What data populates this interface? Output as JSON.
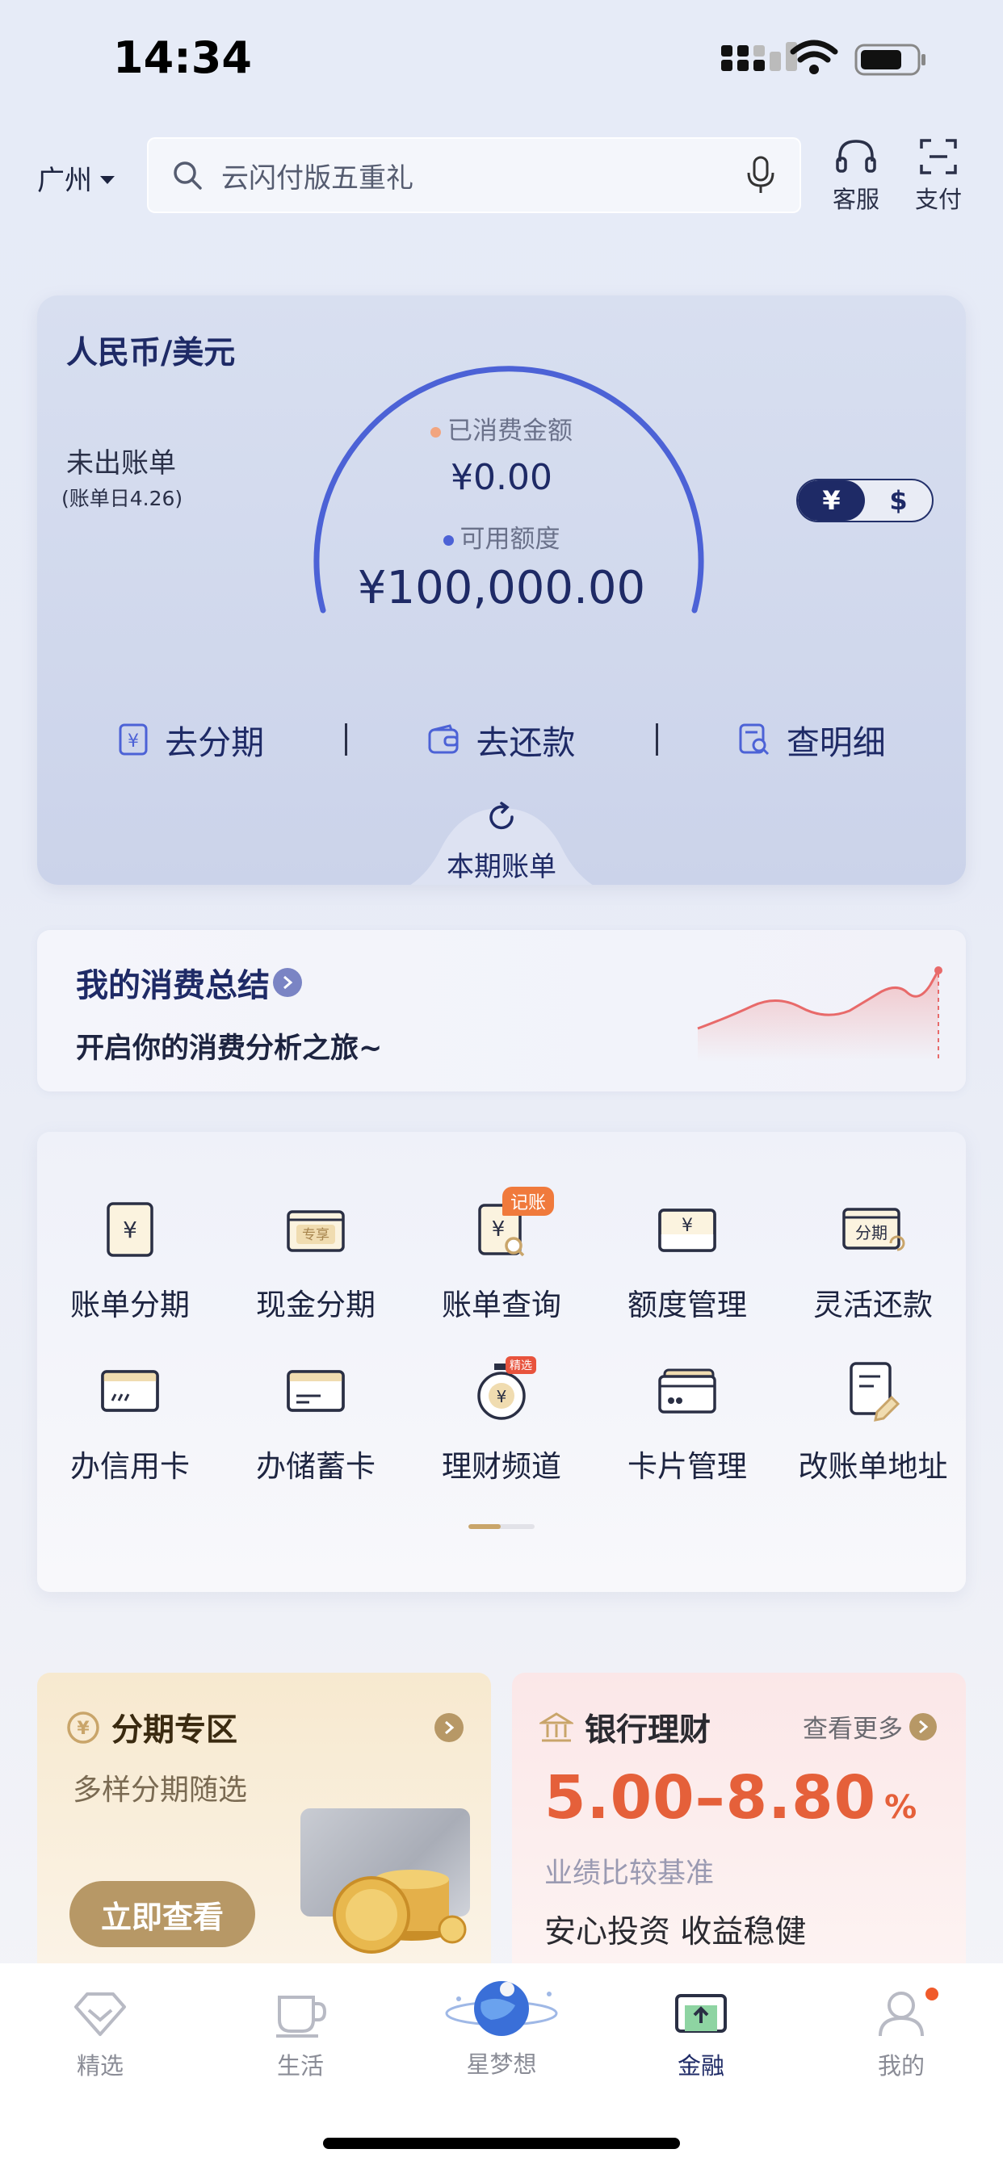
{
  "status": {
    "time": "14:34"
  },
  "header": {
    "city": "广州",
    "search_placeholder": "云闪付版五重礼",
    "service_label": "客服",
    "pay_label": "支付"
  },
  "credit_card": {
    "title": "人民币/美元",
    "unbilled": "未出账单",
    "bill_day": "(账单日4.26)",
    "spent_label": "已消费金额",
    "spent_value": "¥0.00",
    "available_label": "可用额度",
    "available_value": "¥100,000.00",
    "currency_options": [
      "¥",
      "$"
    ],
    "selected_currency": "¥",
    "actions": [
      {
        "label": "去分期",
        "icon": "installment-icon"
      },
      {
        "label": "去还款",
        "icon": "wallet-icon"
      },
      {
        "label": "查明细",
        "icon": "detail-search-icon"
      }
    ],
    "current_bill_label": "本期账单"
  },
  "summary": {
    "title": "我的消费总结",
    "subtitle": "开启你的消费分析之旅~"
  },
  "services": [
    {
      "label": "账单分期",
      "icon": "bill-installment-icon"
    },
    {
      "label": "现金分期",
      "icon": "cash-installment-icon",
      "icon_text": "专享"
    },
    {
      "label": "账单查询",
      "icon": "bill-query-icon",
      "badge": "记账"
    },
    {
      "label": "额度管理",
      "icon": "limit-manage-icon"
    },
    {
      "label": "灵活还款",
      "icon": "flex-repay-icon",
      "icon_text": "分期"
    },
    {
      "label": "办信用卡",
      "icon": "credit-card-apply-icon"
    },
    {
      "label": "办储蓄卡",
      "icon": "debit-card-apply-icon"
    },
    {
      "label": "理财频道",
      "icon": "wealth-channel-icon",
      "badge": "精选"
    },
    {
      "label": "卡片管理",
      "icon": "card-manage-icon"
    },
    {
      "label": "改账单地址",
      "icon": "edit-address-icon"
    }
  ],
  "promo_installment": {
    "title": "分期专区",
    "subtitle": "多样分期随选",
    "button": "立即查看"
  },
  "promo_wealth": {
    "title": "银行理财",
    "more": "查看更多",
    "rate": "5.00–8.80",
    "rate_unit": "%",
    "desc": "业绩比较基准",
    "tagline": "安心投资 收益稳健"
  },
  "nav": [
    {
      "label": "精选",
      "icon": "featured-icon"
    },
    {
      "label": "生活",
      "icon": "cup-icon"
    },
    {
      "label": "星梦想",
      "icon": "planet-icon"
    },
    {
      "label": "金融",
      "icon": "finance-icon",
      "active": true
    },
    {
      "label": "我的",
      "icon": "profile-icon",
      "has_dot": true
    }
  ],
  "colors": {
    "primary": "#1e2a66",
    "gauge": "#4c62d6",
    "accent_orange": "#e5603a",
    "gold": "#b79866"
  }
}
